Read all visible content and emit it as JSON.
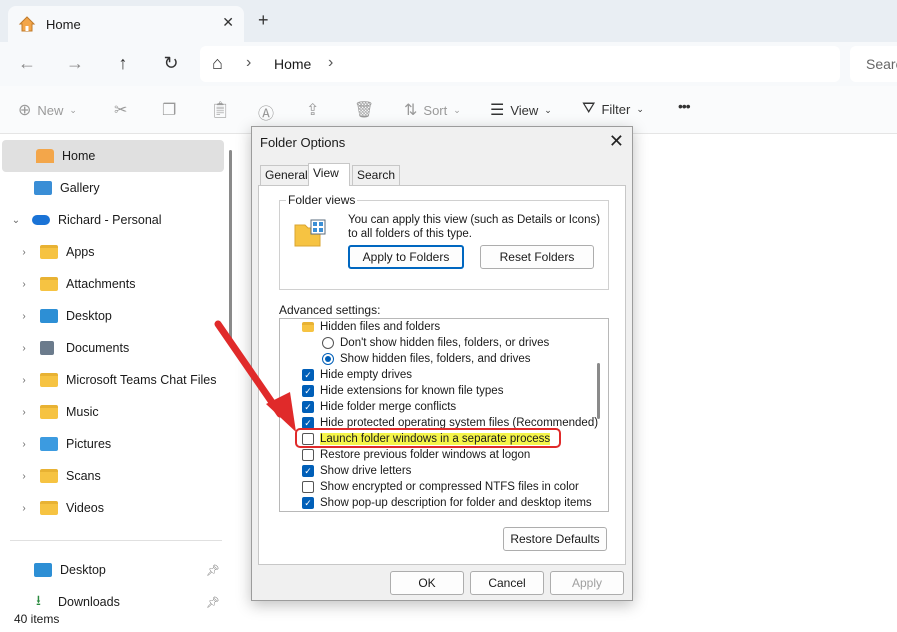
{
  "window": {
    "tab_title": "Home",
    "tab_close": "✕",
    "new_tab": "+"
  },
  "address": {
    "back": "←",
    "forward": "→",
    "up": "↑",
    "refresh": "↻",
    "home_icon": "⌂",
    "separator": "›",
    "crumb": "Home",
    "crumb_chevron": "›",
    "search_placeholder": "Search"
  },
  "commands": {
    "new": "New",
    "sort": "Sort",
    "view": "View",
    "filter": "Filter",
    "more": "•••"
  },
  "sidebar": {
    "items": [
      {
        "label": "Home",
        "icon": "home-icon",
        "selected": true
      },
      {
        "label": "Gallery",
        "icon": "gallery-icon"
      },
      {
        "label": "Richard - Personal",
        "icon": "cloud-icon",
        "expanded": true
      },
      {
        "label": "Apps",
        "icon": "folder-icon"
      },
      {
        "label": "Attachments",
        "icon": "folder-icon"
      },
      {
        "label": "Desktop",
        "icon": "desktop-icon"
      },
      {
        "label": "Documents",
        "icon": "documents-icon"
      },
      {
        "label": "Microsoft Teams Chat Files",
        "icon": "folder-icon"
      },
      {
        "label": "Music",
        "icon": "folder-icon"
      },
      {
        "label": "Pictures",
        "icon": "pictures-icon"
      },
      {
        "label": "Scans",
        "icon": "folder-icon"
      },
      {
        "label": "Videos",
        "icon": "folder-icon"
      }
    ],
    "pinned": [
      {
        "label": "Desktop",
        "icon": "desktop-icon"
      },
      {
        "label": "Downloads",
        "icon": "download-icon"
      }
    ]
  },
  "status": {
    "count": "40 items"
  },
  "dialog": {
    "title": "Folder Options",
    "close": "✕",
    "tabs": [
      "General",
      "View",
      "Search"
    ],
    "active_tab": "View",
    "folder_views": {
      "group_label": "Folder views",
      "text": "You can apply this view (such as Details or Icons) to all folders of this type.",
      "apply_button": "Apply to Folders",
      "reset_button": "Reset Folders"
    },
    "advanced_label": "Advanced settings:",
    "advanced_items": [
      {
        "type": "folder",
        "label": "Hidden files and folders"
      },
      {
        "type": "radio",
        "checked": false,
        "label": "Don't show hidden files, folders, or drives"
      },
      {
        "type": "radio",
        "checked": true,
        "label": "Show hidden files, folders, and drives"
      },
      {
        "type": "checkbox",
        "checked": true,
        "label": "Hide empty drives"
      },
      {
        "type": "checkbox",
        "checked": true,
        "label": "Hide extensions for known file types"
      },
      {
        "type": "checkbox",
        "checked": true,
        "label": "Hide folder merge conflicts"
      },
      {
        "type": "checkbox",
        "checked": true,
        "label": "Hide protected operating system files (Recommended)"
      },
      {
        "type": "checkbox",
        "checked": false,
        "label": "Launch folder windows in a separate process",
        "highlighted": true
      },
      {
        "type": "checkbox",
        "checked": false,
        "label": "Restore previous folder windows at logon"
      },
      {
        "type": "checkbox",
        "checked": true,
        "label": "Show drive letters"
      },
      {
        "type": "checkbox",
        "checked": false,
        "label": "Show encrypted or compressed NTFS files in color"
      },
      {
        "type": "checkbox",
        "checked": true,
        "label": "Show pop-up description for folder and desktop items"
      }
    ],
    "restore_defaults": "Restore Defaults",
    "ok": "OK",
    "cancel": "Cancel",
    "apply": "Apply"
  },
  "colors": {
    "accent": "#005fb8",
    "highlight_fill": "#f5f54a",
    "annotation_red": "#e02a2a"
  }
}
